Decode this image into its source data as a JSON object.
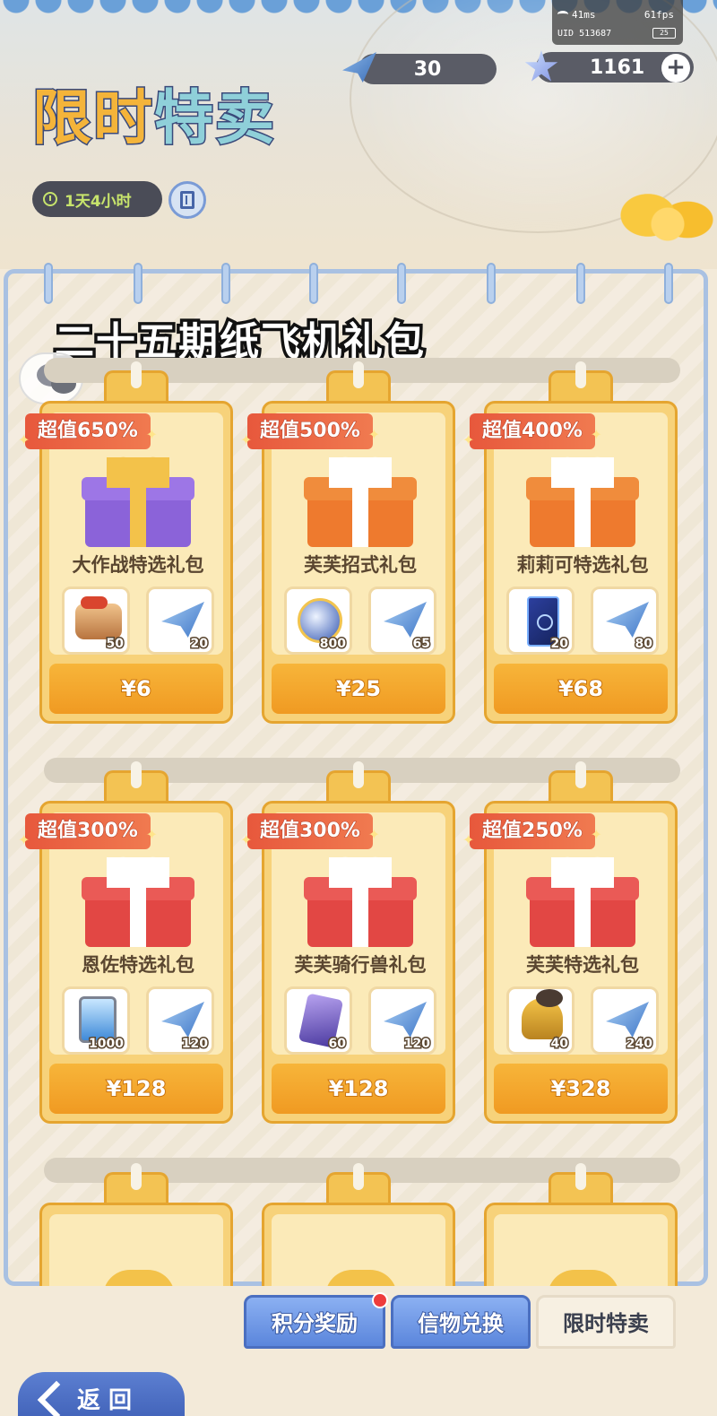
{
  "status": {
    "ping": "41ms",
    "fps": "61fps",
    "uid": "UID 513687",
    "battery": "25"
  },
  "header": {
    "title_part1": "限时",
    "title_part2": "特卖",
    "timer": "1天4小时",
    "currency_a": "30",
    "currency_b": "1161",
    "plus": "+"
  },
  "panel": {
    "title": "二十五期纸飞机礼包",
    "cards": [
      {
        "badge": "超值650%",
        "name": "大作战特选礼包",
        "gift": "purple",
        "items": [
          {
            "icon": "log-icon",
            "count": "50"
          },
          {
            "icon": "plane-icon",
            "count": "20"
          }
        ],
        "price": "¥6"
      },
      {
        "badge": "超值500%",
        "name": "芙芙招式礼包",
        "gift": "orange",
        "items": [
          {
            "icon": "orb-icon",
            "count": "800"
          },
          {
            "icon": "plane-icon",
            "count": "65"
          }
        ],
        "price": "¥25"
      },
      {
        "badge": "超值400%",
        "name": "莉莉可特选礼包",
        "gift": "orange",
        "items": [
          {
            "icon": "tarot-icon",
            "count": "20"
          },
          {
            "icon": "plane-icon",
            "count": "80"
          }
        ],
        "price": "¥68"
      },
      {
        "badge": "超值300%",
        "name": "恩佐特选礼包",
        "gift": "red",
        "items": [
          {
            "icon": "canister-icon",
            "count": "1000"
          },
          {
            "icon": "plane-icon",
            "count": "120"
          }
        ],
        "price": "¥128"
      },
      {
        "badge": "超值300%",
        "name": "芙芙骑行兽礼包",
        "gift": "red",
        "items": [
          {
            "icon": "ticket-icon",
            "count": "60"
          },
          {
            "icon": "plane-icon",
            "count": "120"
          }
        ],
        "price": "¥128"
      },
      {
        "badge": "超值250%",
        "name": "芙芙特选礼包",
        "gift": "red",
        "items": [
          {
            "icon": "bell-icon",
            "count": "40"
          },
          {
            "icon": "plane-icon",
            "count": "240"
          }
        ],
        "price": "¥328"
      }
    ]
  },
  "tabs": {
    "points": "积分奖励",
    "exchange": "信物兑换",
    "limited": "限时特卖"
  },
  "back": {
    "label": "返 回"
  },
  "colors": {
    "accent_blue": "#5b86dc",
    "price_orange": "#f09a22",
    "badge_red": "#e7583c"
  }
}
